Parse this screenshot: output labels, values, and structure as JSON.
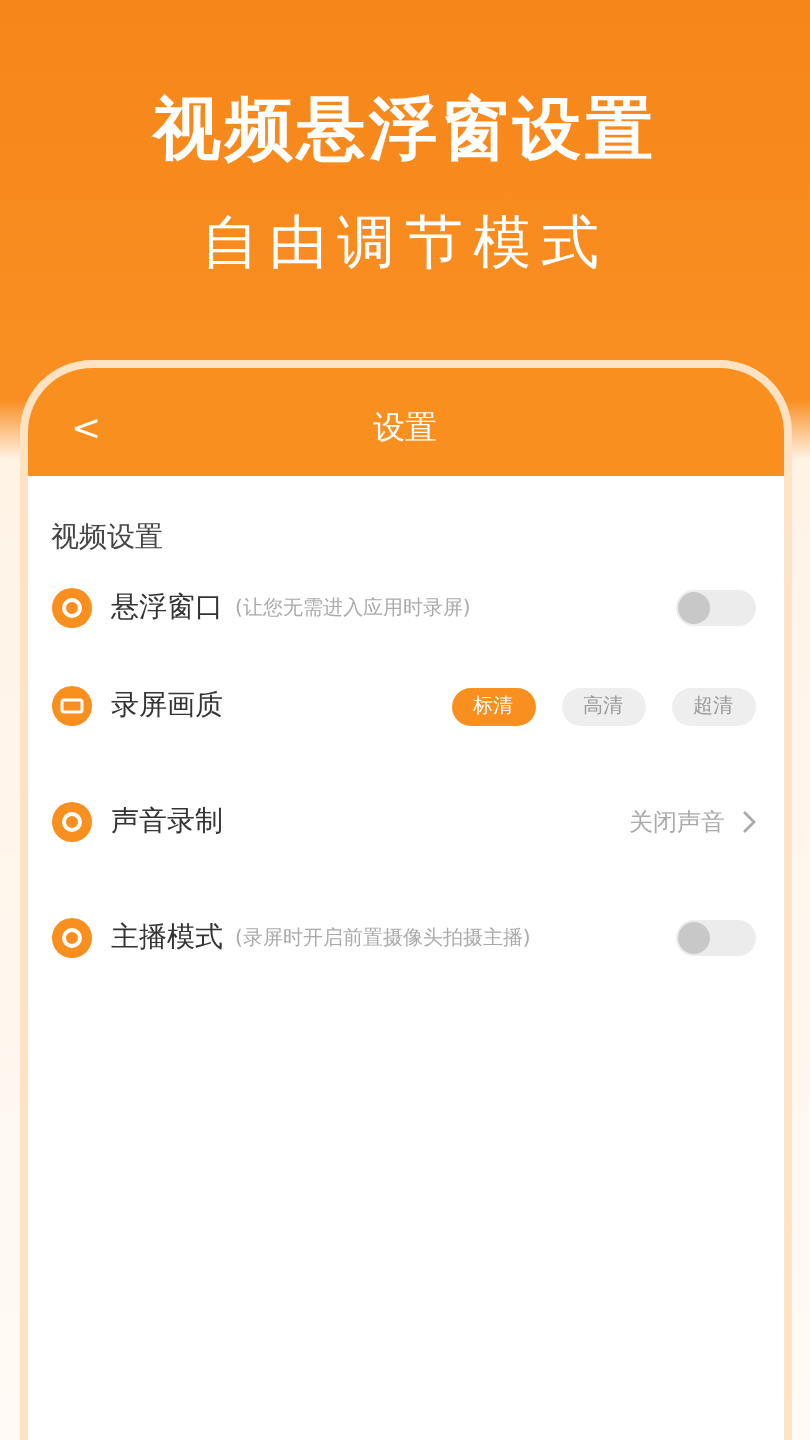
{
  "banner": {
    "title": "视频悬浮窗设置",
    "subtitle": "自由调节模式"
  },
  "app_bar": {
    "back": "<",
    "title": "设置"
  },
  "section": "视频设置",
  "rows": [
    {
      "kind": "toggle",
      "label": "悬浮窗口",
      "hint": "(让您无需进入应用时录屏)",
      "on": false
    },
    {
      "kind": "quality",
      "label": "录屏画质",
      "options": [
        {
          "label": "标清",
          "selected": true
        },
        {
          "label": "高清",
          "selected": false
        },
        {
          "label": "超清",
          "selected": false
        }
      ]
    },
    {
      "kind": "select",
      "label": "声音录制",
      "value": "关闭声音"
    },
    {
      "kind": "toggle",
      "label": "主播模式",
      "hint": "(录屏时开启前置摄像头拍摄主播)",
      "on": false
    }
  ]
}
